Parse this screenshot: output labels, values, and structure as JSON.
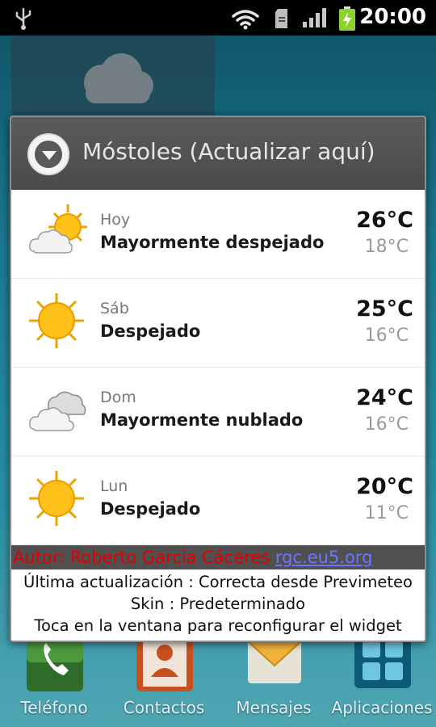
{
  "status_bar": {
    "time": "20:00",
    "icons": [
      "usb-icon",
      "wifi-icon",
      "sd-card-icon",
      "signal-icon",
      "battery-charging-icon"
    ]
  },
  "popup": {
    "header": {
      "title": "Móstoles (Actualizar aquí)",
      "icon": "dropdown-arrow-icon"
    },
    "forecast": [
      {
        "day": "Hoy",
        "condition": "Mayormente despejado",
        "high": "26°C",
        "low": "18°C",
        "icon": "partly-cloudy-icon"
      },
      {
        "day": "Sáb",
        "condition": "Despejado",
        "high": "25°C",
        "low": "16°C",
        "icon": "sunny-icon"
      },
      {
        "day": "Dom",
        "condition": "Mayormente nublado",
        "high": "24°C",
        "low": "16°C",
        "icon": "cloudy-icon"
      },
      {
        "day": "Lun",
        "condition": "Despejado",
        "high": "20°C",
        "low": "11°C",
        "icon": "sunny-icon"
      }
    ],
    "author": {
      "text": "Autor: Roberto García Cáceres",
      "link": "rgc.eu5.org"
    },
    "info": {
      "last_update": "Última actualización : Correcta desde Previmeteo",
      "skin": "Skin : Predeterminado",
      "hint": "Toca en la ventana para reconfigurar el widget"
    }
  },
  "dock": {
    "items": [
      {
        "label": "Teléfono",
        "icon": "phone-icon"
      },
      {
        "label": "Contactos",
        "icon": "contacts-icon"
      },
      {
        "label": "Mensajes",
        "icon": "messages-icon"
      },
      {
        "label": "Aplicaciones",
        "icon": "apps-grid-icon"
      }
    ]
  },
  "colors": {
    "header_bg": "#505050",
    "author_text": "#e00000",
    "author_link": "#6c77ff"
  }
}
